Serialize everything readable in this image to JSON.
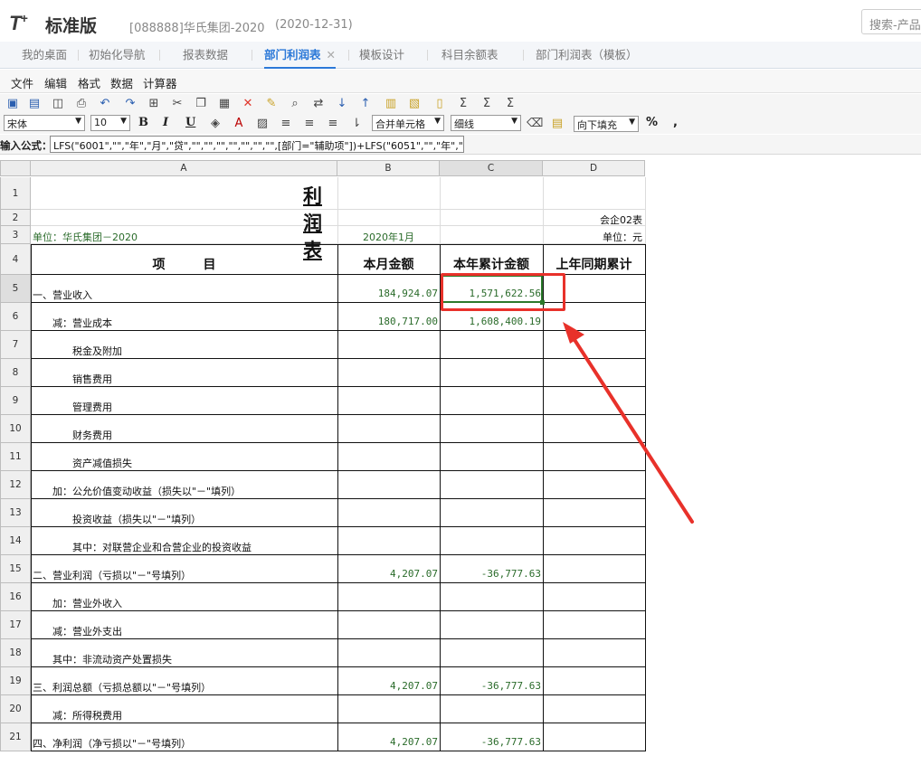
{
  "app": {
    "logo": "T",
    "logo_sup": "+",
    "product": "标准版",
    "account": "[088888]华氏集团-2020",
    "date": "(2020-12-31)",
    "search_placeholder": "搜索-产品"
  },
  "tabs": [
    {
      "label": "我的桌面"
    },
    {
      "label": "初始化导航"
    },
    {
      "label": "报表数据"
    },
    {
      "label": "部门利润表",
      "active": true,
      "close": "✕"
    },
    {
      "label": "模板设计"
    },
    {
      "label": "科目余额表"
    },
    {
      "label": "部门利润表（模板）"
    }
  ],
  "menu": [
    "文件",
    "编辑",
    "格式",
    "数据",
    "计算器"
  ],
  "toolbar": {
    "font": "宋体",
    "size": "10",
    "bold": "B",
    "italic": "I",
    "underline": "U",
    "merge": "合并单元格",
    "border": "细线",
    "fill": "向下填充",
    "percent": "%",
    "comma": ","
  },
  "formula": {
    "label": "输入公式：",
    "value": "LFS(\"6001\",\"\",\"年\",\"月\",\"贷\",\"\",\"\",\"\",\"\",\"\",\"\",\"\",[部门=\"辅助项\"])+LFS(\"6051\",\"\",\"年\",\"月\",\"贷\",\"\",\"\",\"\","
  },
  "columns": [
    "A",
    "B",
    "C",
    "D"
  ],
  "rows": [
    "1",
    "2",
    "3",
    "4",
    "5",
    "6",
    "7",
    "8",
    "9",
    "10",
    "11",
    "12",
    "13",
    "14",
    "15",
    "16",
    "17",
    "18",
    "19",
    "20",
    "21"
  ],
  "report": {
    "title": "利润表",
    "form_code": "会企02表",
    "unit_label": "单位：华氏集团－2020",
    "period": "2020年1月",
    "currency": "单位：元",
    "headers": [
      "项　　　目",
      "本月金额",
      "本年累计金额",
      "上年同期累计"
    ],
    "lines": [
      {
        "item": "一、营业收入",
        "month": "184,924.07",
        "ytd": "1,571,622.56"
      },
      {
        "item": "　　减：营业成本",
        "month": "180,717.00",
        "ytd": "1,608,400.19"
      },
      {
        "item": "　　　　税金及附加",
        "month": "",
        "ytd": ""
      },
      {
        "item": "　　　　销售费用",
        "month": "",
        "ytd": ""
      },
      {
        "item": "　　　　管理费用",
        "month": "",
        "ytd": ""
      },
      {
        "item": "　　　　财务费用",
        "month": "",
        "ytd": ""
      },
      {
        "item": "　　　　资产减值损失",
        "month": "",
        "ytd": ""
      },
      {
        "item": "　　加：公允价值变动收益（损失以\"－\"填列）",
        "month": "",
        "ytd": ""
      },
      {
        "item": "　　　　投资收益（损失以\"－\"填列）",
        "month": "",
        "ytd": ""
      },
      {
        "item": "　　　　其中：对联营企业和合营企业的投资收益",
        "month": "",
        "ytd": ""
      },
      {
        "item": "二、营业利润（亏损以\"－\"号填列）",
        "month": "4,207.07",
        "ytd": "-36,777.63"
      },
      {
        "item": "　　加：营业外收入",
        "month": "",
        "ytd": ""
      },
      {
        "item": "　　减：营业外支出",
        "month": "",
        "ytd": ""
      },
      {
        "item": "　　其中：非流动资产处置损失",
        "month": "",
        "ytd": ""
      },
      {
        "item": "三、利润总额（亏损总额以\"－\"号填列）",
        "month": "4,207.07",
        "ytd": "-36,777.63"
      },
      {
        "item": "　　减：所得税费用",
        "month": "",
        "ytd": ""
      },
      {
        "item": "四、净利润（净亏损以\"－\"号填列）",
        "month": "4,207.07",
        "ytd": "-36,777.63"
      }
    ]
  },
  "colors": {
    "accent": "#2b78d8",
    "annotation": "#e8312a",
    "value_green": "#2a6b2a"
  }
}
